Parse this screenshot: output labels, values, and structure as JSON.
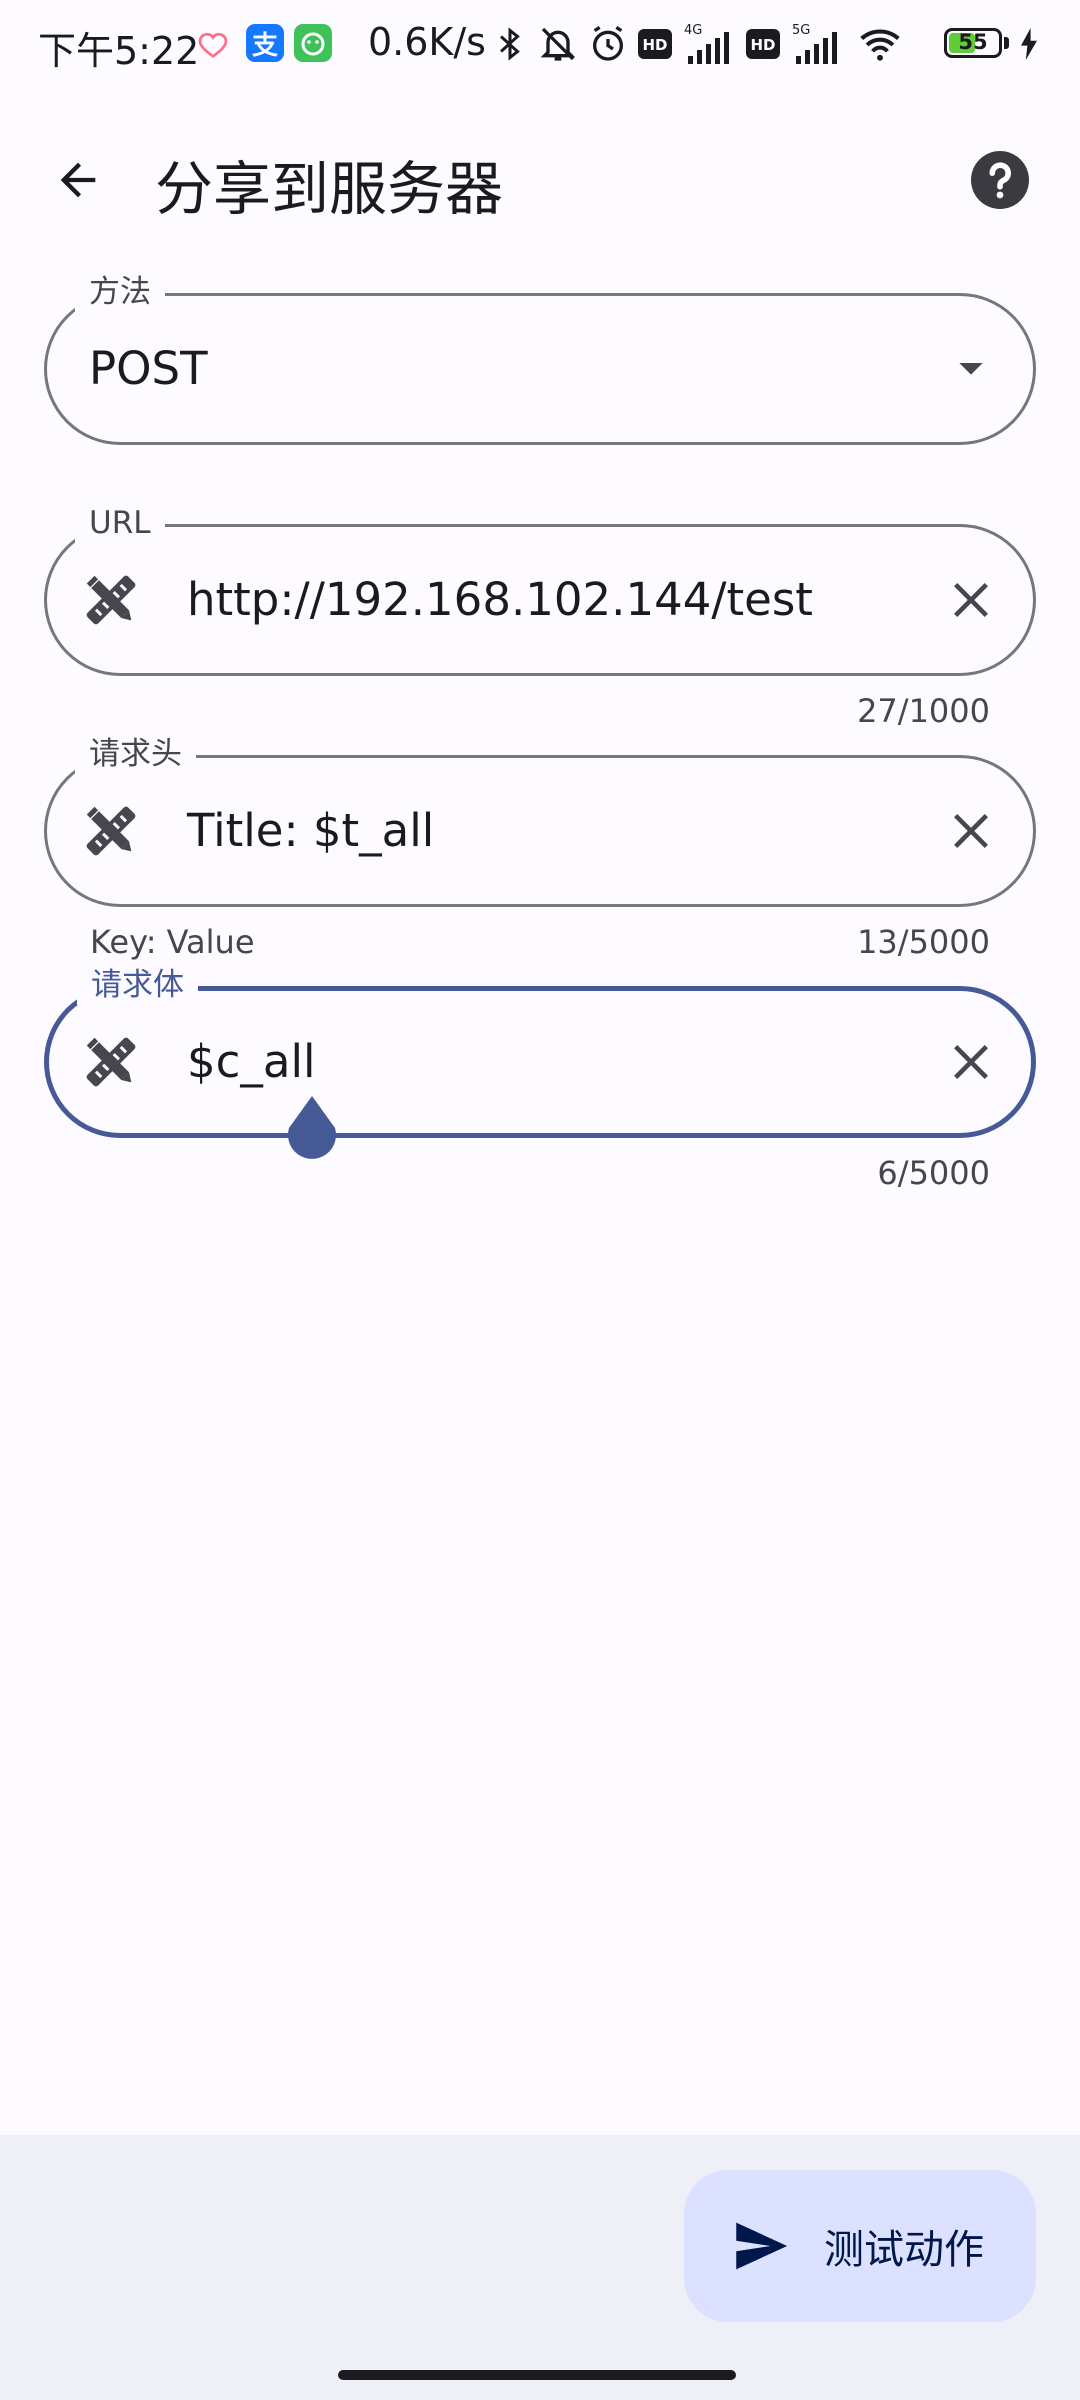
{
  "status_bar": {
    "time": "下午5:22",
    "net_speed": "0.6K/s",
    "battery_level": "55",
    "battery_fill_fraction": 0.55,
    "icons": [
      "heart-icon",
      "alipay-icon",
      "app-icon",
      "bluetooth-icon",
      "mute-bell-icon",
      "alarm-icon",
      "hd-icon",
      "signal-4g-icon",
      "hd-icon",
      "signal-5g-icon",
      "wifi-icon",
      "battery-icon",
      "charging-icon"
    ]
  },
  "app_bar": {
    "title": "分享到服务器",
    "back_icon": "arrow-back-icon",
    "help_icon": "help-icon"
  },
  "form": {
    "method": {
      "label": "方法",
      "value": "POST",
      "icon": "dropdown-arrow-icon"
    },
    "url": {
      "label": "URL",
      "value": "http://192.168.102.144/test",
      "counter": "27/1000"
    },
    "headers": {
      "label": "请求头",
      "value": "Title: $t_all",
      "helper": "Key: Value",
      "counter": "13/5000"
    },
    "body": {
      "label": "请求体",
      "value": "$c_all",
      "counter": "6/5000"
    }
  },
  "fab": {
    "label": "测试动作",
    "icon": "send-icon"
  },
  "colors": {
    "primary": "#455a96",
    "fab_container": "#dbe1ff",
    "background": "#fdfbff",
    "bottom_bar": "#efeff7",
    "outline": "#77767d"
  }
}
